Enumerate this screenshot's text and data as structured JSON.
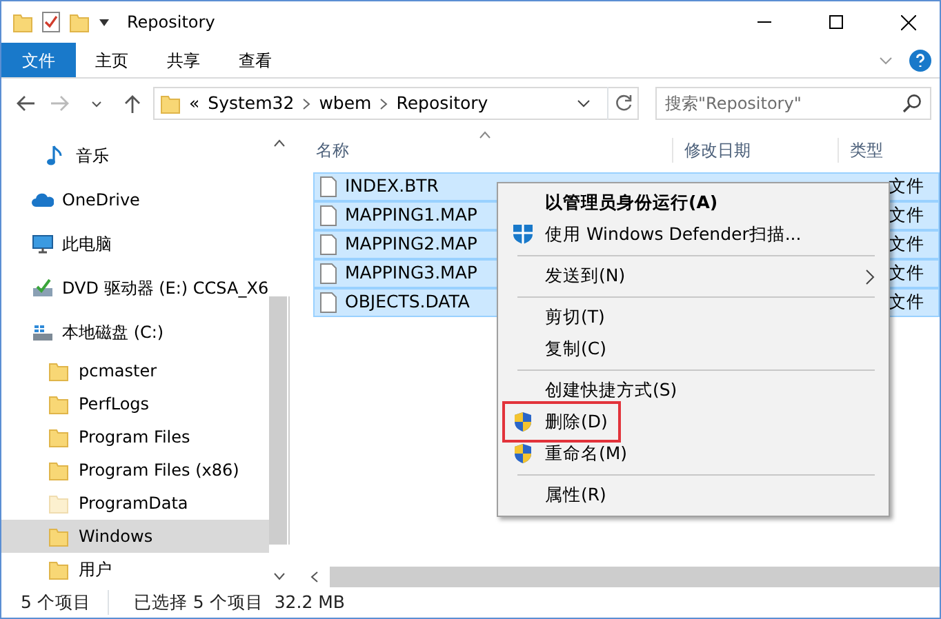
{
  "window": {
    "title": "Repository"
  },
  "ribbon_tabs": [
    {
      "label": "文件",
      "selected": true
    },
    {
      "label": "主页",
      "selected": false
    },
    {
      "label": "共享",
      "selected": false
    },
    {
      "label": "查看",
      "selected": false
    }
  ],
  "address": {
    "overflow": "«",
    "path": [
      "System32",
      "wbem",
      "Repository"
    ]
  },
  "search": {
    "placeholder": "搜索\"Repository\""
  },
  "sidebar": {
    "items": [
      {
        "label": "音乐",
        "kind": "music",
        "selected": false
      },
      {
        "label": "OneDrive",
        "kind": "cloud",
        "selected": false
      },
      {
        "label": "此电脑",
        "kind": "pc",
        "selected": false
      },
      {
        "label": "DVD 驱动器 (E:) CCSA_X6",
        "kind": "dvd",
        "selected": false
      },
      {
        "label": "本地磁盘 (C:)",
        "kind": "drive",
        "selected": false,
        "children": [
          {
            "label": "pcmaster",
            "kind": "folder",
            "selected": false
          },
          {
            "label": "PerfLogs",
            "kind": "folder",
            "selected": false
          },
          {
            "label": "Program Files",
            "kind": "folder",
            "selected": false
          },
          {
            "label": "Program Files (x86)",
            "kind": "folder",
            "selected": false
          },
          {
            "label": "ProgramData",
            "kind": "hidden-folder",
            "selected": false
          },
          {
            "label": "Windows",
            "kind": "folder",
            "selected": true
          },
          {
            "label": "用户",
            "kind": "folder",
            "selected": false
          }
        ]
      }
    ]
  },
  "file_list": {
    "columns": [
      "名称",
      "修改日期",
      "类型"
    ],
    "rows": [
      {
        "name": "INDEX.BTR",
        "type": "文件",
        "selected": true
      },
      {
        "name": "MAPPING1.MAP",
        "type": "文件",
        "selected": true
      },
      {
        "name": "MAPPING2.MAP",
        "type": "文件",
        "selected": true
      },
      {
        "name": "MAPPING3.MAP",
        "type": "文件",
        "selected": true
      },
      {
        "name": "OBJECTS.DATA",
        "type": "文件",
        "selected": true
      }
    ]
  },
  "context_menu": {
    "groups": [
      [
        {
          "label": "以管理员身份运行(A)",
          "bold": true
        },
        {
          "label": "使用 Windows Defender扫描...",
          "kind": "defender"
        }
      ],
      [
        {
          "label": "发送到(N)",
          "submenu": true
        }
      ],
      [
        {
          "label": "剪切(T)"
        },
        {
          "label": "复制(C)"
        }
      ],
      [
        {
          "label": "创建快捷方式(S)"
        },
        {
          "label": "删除(D)",
          "kind": "uac",
          "outlined": true
        },
        {
          "label": "重命名(M)",
          "kind": "uac"
        }
      ],
      [
        {
          "label": "属性(R)"
        }
      ]
    ]
  },
  "status_bar": {
    "item_count": "5 个项目",
    "selection": "已选择 5 个项目",
    "size": "32.2 MB"
  }
}
